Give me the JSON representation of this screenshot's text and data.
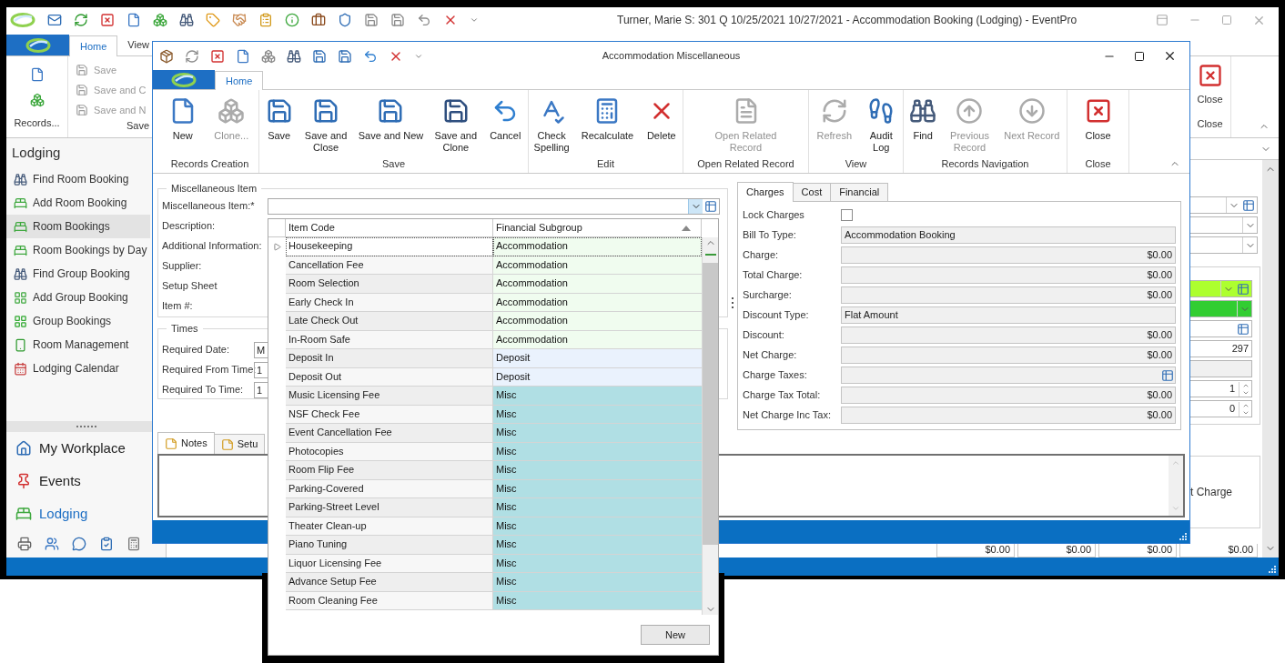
{
  "main_window": {
    "title": "Turner, Marie S: 301 Q 10/25/2021 10/27/2021  - Accommodation Booking (Lodging) - EventPro",
    "ribbon_tabs": [
      {
        "label": "Home",
        "selected": true
      },
      {
        "label": "View",
        "selected": false
      }
    ],
    "records_group": {
      "label": "Records..."
    },
    "save_group": {
      "label": "Save",
      "items": [
        {
          "label": "Save",
          "disabled": true
        },
        {
          "label": "Save and C",
          "disabled": true
        },
        {
          "label": "Save and N",
          "disabled": true
        }
      ]
    },
    "close_group": {
      "button": "Close",
      "label": "Close"
    },
    "sidebar": {
      "title": "Lodging",
      "items": [
        {
          "label": "Find Room Booking",
          "selected": false
        },
        {
          "label": "Add Room Booking",
          "selected": false
        },
        {
          "label": "Room Bookings",
          "selected": true
        },
        {
          "label": "Room Bookings by Day",
          "selected": false
        },
        {
          "label": "Find Group Booking",
          "selected": false
        },
        {
          "label": "Add Group Booking",
          "selected": false
        },
        {
          "label": "Group Bookings",
          "selected": false
        },
        {
          "label": "Room Management",
          "selected": false
        },
        {
          "label": "Lodging Calendar",
          "selected": false
        }
      ],
      "nav": [
        {
          "label": "My Workplace",
          "selected": false
        },
        {
          "label": "Events",
          "selected": false
        },
        {
          "label": "Lodging",
          "selected": true
        }
      ]
    },
    "fields_top": [
      {
        "kind": "lookup-combo"
      },
      {
        "kind": "combo"
      },
      {
        "kind": "combo"
      }
    ],
    "fields_group": [
      {
        "kind": "lookup-combo",
        "color": "#adff2f"
      },
      {
        "kind": "combo",
        "color": "#32cd32"
      },
      {
        "kind": "lookup"
      },
      {
        "kind": "number",
        "value": "297"
      },
      {
        "kind": "text"
      },
      {
        "kind": "spin",
        "value": "1"
      },
      {
        "kind": "spin",
        "value": "0"
      }
    ],
    "grid_header": "t Charge",
    "totals": [
      "$0.00",
      "$0.00",
      "$0.00",
      "$0.00"
    ]
  },
  "dialog": {
    "title": "Accommodation Miscellaneous",
    "ribbon_tabs": [
      {
        "label": "Home",
        "selected": true
      }
    ],
    "ribbon_groups": [
      {
        "label": "Records Creation",
        "buttons": [
          {
            "label": "New",
            "disabled": false
          },
          {
            "label": "Clone...",
            "disabled": true
          }
        ]
      },
      {
        "label": "Save",
        "buttons": [
          {
            "label": "Save",
            "disabled": false
          },
          {
            "label": "Save and Close",
            "disabled": false
          },
          {
            "label": "Save and New",
            "disabled": false
          },
          {
            "label": "Save and Clone",
            "disabled": false
          },
          {
            "label": "Cancel",
            "disabled": false
          }
        ]
      },
      {
        "label": "Edit",
        "buttons": [
          {
            "label": "Check Spelling",
            "disabled": false
          },
          {
            "label": "Recalculate",
            "disabled": false
          },
          {
            "label": "Delete",
            "disabled": false
          }
        ]
      },
      {
        "label": "Open Related Record",
        "buttons": [
          {
            "label": "Open Related Record",
            "disabled": true
          }
        ]
      },
      {
        "label": "View",
        "buttons": [
          {
            "label": "Refresh",
            "disabled": true
          },
          {
            "label": "Audit Log",
            "disabled": false
          }
        ]
      },
      {
        "label": "Records Navigation",
        "buttons": [
          {
            "label": "Find",
            "disabled": false
          },
          {
            "label": "Previous Record",
            "disabled": true
          },
          {
            "label": "Next Record",
            "disabled": true
          }
        ]
      },
      {
        "label": "Close",
        "buttons": [
          {
            "label": "Close",
            "disabled": false
          }
        ]
      }
    ],
    "item_group": {
      "title": "Miscellaneous Item",
      "labels": [
        "Miscellaneous Item:*",
        "Description:",
        "Additional Information:",
        "Supplier:",
        "Setup Sheet",
        "Item #:"
      ]
    },
    "times_group": {
      "title": "Times",
      "fields": [
        {
          "label": "Required Date:",
          "value": "M"
        },
        {
          "label": "Required From Time:",
          "value": "1"
        },
        {
          "label": "Required To Time:",
          "value": "1"
        }
      ]
    },
    "note_tabs": [
      {
        "label": "Notes",
        "selected": true
      },
      {
        "label": "Setu",
        "selected": false
      }
    ],
    "charge_tabs": [
      {
        "label": "Charges",
        "selected": true
      },
      {
        "label": "Cost",
        "selected": false
      },
      {
        "label": "Financial",
        "selected": false
      }
    ],
    "charges": [
      {
        "kind": "checkbox",
        "label": "Lock Charges",
        "checked": false
      },
      {
        "kind": "text",
        "label": "Bill To Type:",
        "value": "Accommodation Booking"
      },
      {
        "kind": "amount",
        "label": "Charge:",
        "value": "$0.00"
      },
      {
        "kind": "amount",
        "label": "Total Charge:",
        "value": "$0.00"
      },
      {
        "kind": "amount",
        "label": "Surcharge:",
        "value": "$0.00"
      },
      {
        "kind": "text",
        "label": "Discount Type:",
        "value": "Flat Amount"
      },
      {
        "kind": "amount",
        "label": "Discount:",
        "value": "$0.00"
      },
      {
        "kind": "amount",
        "label": "Net Charge:",
        "value": "$0.00"
      },
      {
        "kind": "lookup",
        "label": "Charge Taxes:"
      },
      {
        "kind": "amount",
        "label": "Charge Tax Total:",
        "value": "$0.00"
      },
      {
        "kind": "amount",
        "label": "Net Charge Inc Tax:",
        "value": "$0.00"
      }
    ]
  },
  "dropdown": {
    "columns": [
      {
        "label": "Item Code",
        "sorted": false
      },
      {
        "label": "Financial Subgroup",
        "sorted": true
      }
    ],
    "rows": [
      {
        "code": "Housekeeping",
        "subgroup": "Accommodation",
        "color": "#f0fcef",
        "selected": true
      },
      {
        "code": "Cancellation Fee",
        "subgroup": "Accommodation",
        "color": "#f0fcef",
        "selected": false
      },
      {
        "code": "Room Selection",
        "subgroup": "Accommodation",
        "color": "#f0fcef",
        "selected": false
      },
      {
        "code": "Early Check In",
        "subgroup": "Accommodation",
        "color": "#f0fcef",
        "selected": false
      },
      {
        "code": "Late Check Out",
        "subgroup": "Accommodation",
        "color": "#f0fcef",
        "selected": false
      },
      {
        "code": "In-Room Safe",
        "subgroup": "Accommodation",
        "color": "#f0fcef",
        "selected": false
      },
      {
        "code": "Deposit In",
        "subgroup": "Deposit",
        "color": "#eaf2fd",
        "selected": false
      },
      {
        "code": "Deposit Out",
        "subgroup": "Deposit",
        "color": "#eaf2fd",
        "selected": false
      },
      {
        "code": "Music Licensing Fee",
        "subgroup": "Misc",
        "color": "#b0dfe4",
        "selected": false
      },
      {
        "code": "NSF Check Fee",
        "subgroup": "Misc",
        "color": "#b0dfe4",
        "selected": false
      },
      {
        "code": "Event Cancellation Fee",
        "subgroup": "Misc",
        "color": "#b0dfe4",
        "selected": false
      },
      {
        "code": "Photocopies",
        "subgroup": "Misc",
        "color": "#b0dfe4",
        "selected": false
      },
      {
        "code": "Room Flip Fee",
        "subgroup": "Misc",
        "color": "#b0dfe4",
        "selected": false
      },
      {
        "code": "Parking-Covered",
        "subgroup": "Misc",
        "color": "#b0dfe4",
        "selected": false
      },
      {
        "code": "Parking-Street Level",
        "subgroup": "Misc",
        "color": "#b0dfe4",
        "selected": false
      },
      {
        "code": "Theater Clean-up",
        "subgroup": "Misc",
        "color": "#b0dfe4",
        "selected": false
      },
      {
        "code": "Piano Tuning",
        "subgroup": "Misc",
        "color": "#b0dfe4",
        "selected": false
      },
      {
        "code": "Liquor Licensing Fee",
        "subgroup": "Misc",
        "color": "#b0dfe4",
        "selected": false
      },
      {
        "code": "Advance Setup Fee",
        "subgroup": "Misc",
        "color": "#b0dfe4",
        "selected": false
      },
      {
        "code": "Room Cleaning Fee",
        "subgroup": "Misc",
        "color": "#b0dfe4",
        "selected": false
      }
    ],
    "button": "New"
  }
}
